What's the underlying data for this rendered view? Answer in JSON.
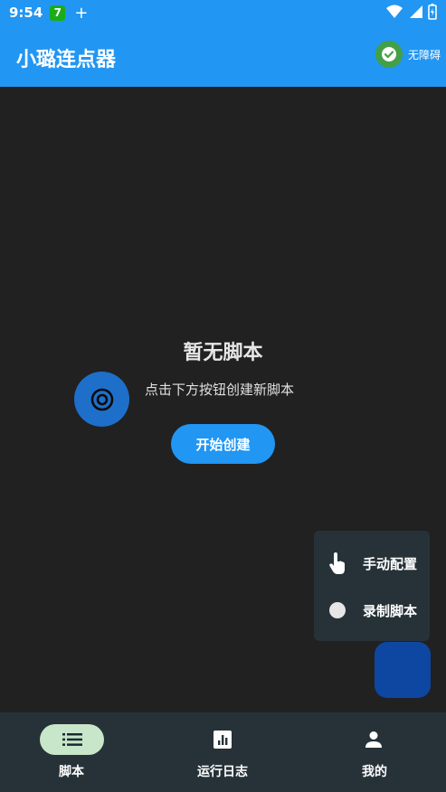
{
  "status_bar": {
    "time": "9:54",
    "badge": "7",
    "plus": "+"
  },
  "app_bar": {
    "title": "小璐连点器",
    "accessibility_label": "无障碍"
  },
  "empty_state": {
    "title": "暂无脚本",
    "subtitle": "点击下方按钮创建新脚本",
    "start_button": "开始创建"
  },
  "dial_menu": {
    "items": [
      {
        "label": "手动配置",
        "icon": "hand-pointer-icon"
      },
      {
        "label": "录制脚本",
        "icon": "record-dot-icon"
      }
    ]
  },
  "bottom_nav": {
    "items": [
      {
        "label": "脚本",
        "icon": "list-icon",
        "active": true
      },
      {
        "label": "运行日志",
        "icon": "chart-icon",
        "active": false
      },
      {
        "label": "我的",
        "icon": "person-icon",
        "active": false
      }
    ]
  },
  "colors": {
    "primary": "#2196F3",
    "background": "#212121",
    "nav_background": "#263238",
    "fab": "#0D47A1",
    "success": "#43A047",
    "nav_indicator": "#C8E6C9"
  }
}
